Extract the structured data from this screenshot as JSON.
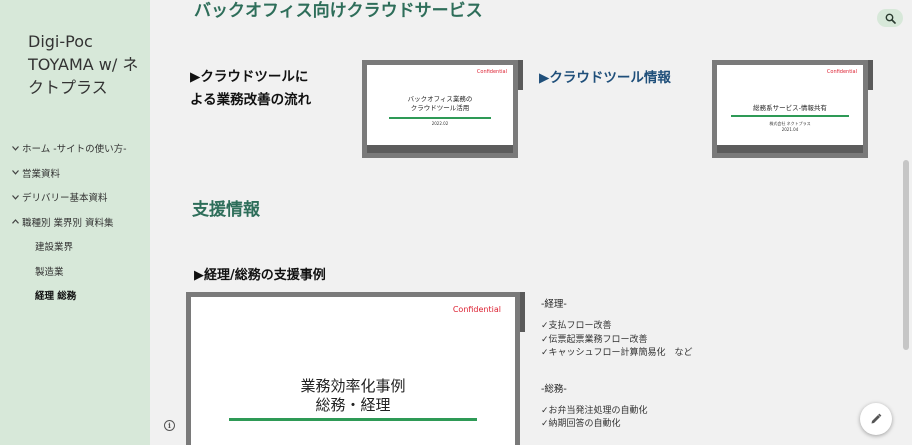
{
  "sidebar": {
    "site_title": "Digi-Poc TOYAMA w/ ネクトプラス",
    "items": [
      {
        "label": "ホーム -サイトの使い方-",
        "chevron": "chevron-down"
      },
      {
        "label": "営業資料",
        "chevron": "chevron-down"
      },
      {
        "label": "デリバリー基本資料",
        "chevron": "chevron-down"
      },
      {
        "label": "職種別 業界別 資料集",
        "chevron": "chevron-up"
      }
    ],
    "subitems": [
      {
        "label": "建設業界"
      },
      {
        "label": "製造業"
      },
      {
        "label": "経理 総務"
      }
    ]
  },
  "main": {
    "top_title": "バックオフィス向けクラウドサービス",
    "cloud_section_1": {
      "heading_line1": "▶クラウドツールに",
      "heading_line2": "よる業務改善の流れ"
    },
    "cloud_section_2": {
      "heading": "▶クラウドツール情報"
    },
    "slide1": {
      "confidential": "Confidential",
      "title_line1": "バックオフィス業務の",
      "title_line2": "クラウドツール活用",
      "date": "2022.02"
    },
    "slide2": {
      "confidential": "Confidential",
      "title": "総務系サービス-情報共有",
      "company": "株式会社 ネクトプラス",
      "date": "2021.04"
    },
    "support_heading": "支援情報",
    "case_heading": "▶経理/総務の支援事例",
    "slide3": {
      "confidential": "Confidential",
      "title_line1": "業務効率化事例",
      "title_line2": "総務・経理"
    },
    "notes": {
      "keiri_head": "-経理-",
      "keiri_items": [
        "✓支払フロー改善",
        "✓伝票起票業務フロー改善",
        "✓キャッシュフロー計算簡易化　など"
      ],
      "soumu_head": "-総務-",
      "soumu_items": [
        "✓お弁当発注処理の自動化",
        "✓納期回答の自動化"
      ]
    }
  },
  "icons": {
    "search": "search-icon",
    "edit": "pencil-icon",
    "info": "info-icon"
  },
  "colors": {
    "sidebar_bg": "#d7e8d9",
    "heading_green": "#2e6e5a",
    "link_blue": "#1f4f7a",
    "accent_green": "#2e9a56",
    "confidential_red": "#dd2233"
  }
}
